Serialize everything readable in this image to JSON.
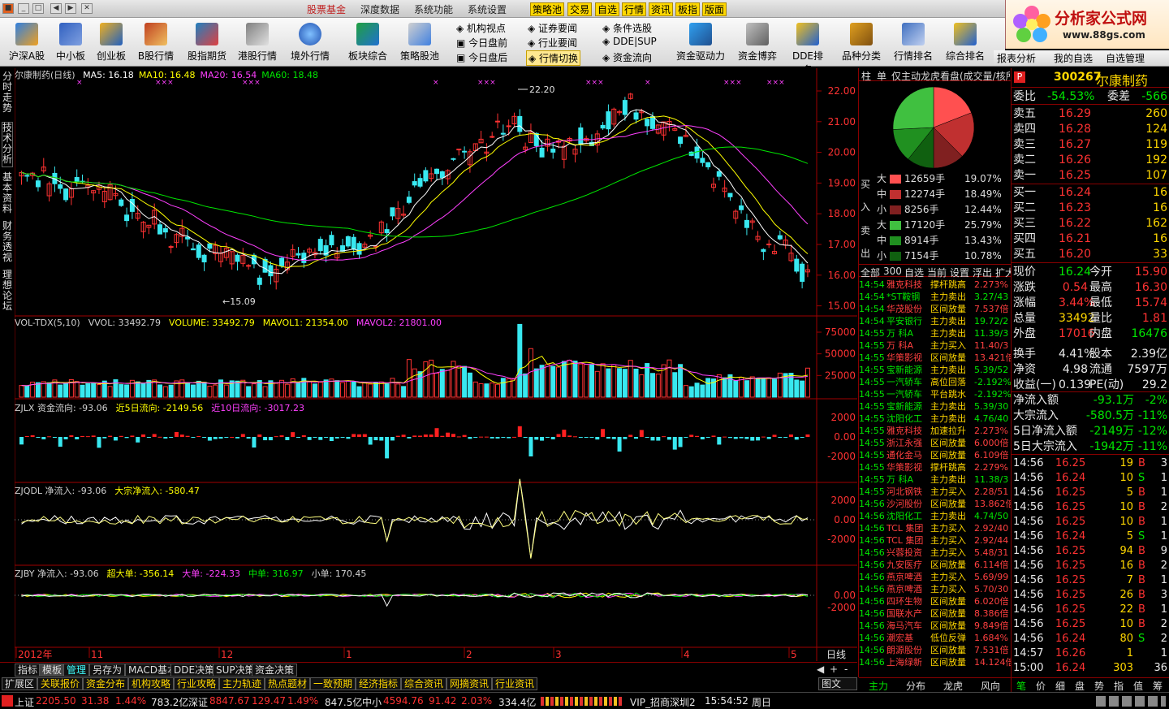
{
  "menu": {
    "items": [
      "股票基金",
      "深度数据",
      "系统功能",
      "系统设置"
    ],
    "tags": [
      "策略池",
      "交易",
      "自选",
      "行情",
      "资讯",
      "板指",
      "版面"
    ]
  },
  "logo": {
    "title": "分析家公式网",
    "url": "www.88gs.com"
  },
  "toolbar": {
    "big": [
      "沪深A股",
      "中小板",
      "创业板",
      "B股行情",
      "股指期货",
      "港股行情",
      "境外行情",
      "板块综合",
      "策略股池"
    ],
    "small1": [
      "机构视点",
      "今日盘前",
      "今日盘后"
    ],
    "small2": [
      "证券要闻",
      "行业要闻",
      "行情切换"
    ],
    "small3": [
      "条件选股",
      "DDE|SUP",
      "资金流向"
    ],
    "big2": [
      "资金驱动力",
      "资金博弈",
      "DDE排名",
      "品种分类",
      "行情排名",
      "综合排名",
      "报表分析",
      "我的自选",
      "自选管理"
    ]
  },
  "sidetabs": [
    "分时走势",
    "技术分析",
    "基本资料",
    "财务透视",
    "理想论坛"
  ],
  "main": {
    "title": "尔康制药(日线)",
    "ma": [
      {
        "label": "MA5: 16.18",
        "color": "#ffffff"
      },
      {
        "label": "MA10: 16.48",
        "color": "#ffff00"
      },
      {
        "label": "MA20: 16.54",
        "color": "#ff40ff"
      },
      {
        "label": "MA60: 18.48",
        "color": "#00e600"
      }
    ],
    "yticks": [
      "22.00",
      "21.00",
      "20.00",
      "19.00",
      "18.00",
      "17.00",
      "16.00",
      "15.00"
    ],
    "high_label": "22.20",
    "low_label": "15.09"
  },
  "vol": {
    "labels": [
      {
        "t": "VOL-TDX(5,10)",
        "c": "#d0d0d0"
      },
      {
        "t": "VVOL: 33492.79",
        "c": "#d0d0d0"
      },
      {
        "t": "VOLUME: 33492.79",
        "c": "#ffff00"
      },
      {
        "t": "MAVOL1: 21354.00",
        "c": "#ffff00"
      },
      {
        "t": "MAVOL2: 21801.00",
        "c": "#ff40ff"
      }
    ],
    "yticks": [
      "75000",
      "50000",
      "25000"
    ]
  },
  "zjlx": {
    "labels": [
      {
        "t": "ZJLX 资金流向: -93.06",
        "c": "#d0d0d0"
      },
      {
        "t": "近5日流向: -2149.56",
        "c": "#ffff00"
      },
      {
        "t": "近10日流向: -3017.23",
        "c": "#ff40ff"
      }
    ],
    "yticks": [
      "2000",
      "0.00",
      "-2000"
    ]
  },
  "zjqdl": {
    "labels": [
      {
        "t": "ZJQDL 净流入: -93.06",
        "c": "#d0d0d0"
      },
      {
        "t": "大宗净流入: -580.47",
        "c": "#ffff00"
      }
    ],
    "yticks": [
      "2000",
      "0.00",
      "-2000"
    ]
  },
  "zjby": {
    "labels": [
      {
        "t": "ZJBY 净流入: -93.06",
        "c": "#d0d0d0"
      },
      {
        "t": "超大单: -356.14",
        "c": "#ffff00"
      },
      {
        "t": "大单: -224.33",
        "c": "#ff40ff"
      },
      {
        "t": "中单: 316.97",
        "c": "#00e600"
      },
      {
        "t": "小单: 170.45",
        "c": "#d0d0d0"
      }
    ],
    "yticks": [
      "0.00",
      "-2000"
    ]
  },
  "xaxis": {
    "labels": [
      "2012年",
      "11",
      "12",
      "1",
      "2",
      "3",
      "4",
      "5"
    ],
    "period": "日线"
  },
  "bottomtabs": [
    "指标",
    "模板",
    "管理",
    "另存为",
    "MACD基本",
    "DDE决策",
    "SUP决策",
    "资金决策"
  ],
  "bottomtabs2": [
    "扩展区",
    "关联报价",
    "资金分布",
    "机构攻略",
    "行业攻略",
    "主力轨迹",
    "热点题材",
    "一致预期",
    "经济指标",
    "综合资讯",
    "网摘资讯",
    "行业资讯"
  ],
  "pie_panel": {
    "tabs": [
      "柱",
      "单",
      "仅主动",
      "龙虎看盘(成交量/核所"
    ],
    "flow": [
      {
        "side": "买入",
        "rows": [
          {
            "s": "大",
            "v": "12659手",
            "p": "19.07%",
            "c": "#ff5050"
          },
          {
            "s": "中",
            "v": "12274手",
            "p": "18.49%",
            "c": "#c03030"
          },
          {
            "s": "小",
            "v": "8256手",
            "p": "12.44%",
            "c": "#802020"
          }
        ]
      },
      {
        "side": "卖出",
        "rows": [
          {
            "s": "大",
            "v": "17120手",
            "p": "25.79%",
            "c": "#40c040"
          },
          {
            "s": "中",
            "v": "8914手",
            "p": "13.43%",
            "c": "#209020"
          },
          {
            "s": "小",
            "v": "7154手",
            "p": "10.78%",
            "c": "#106010"
          }
        ]
      }
    ],
    "slices": [
      19.07,
      18.49,
      12.44,
      10.78,
      13.43,
      25.79
    ]
  },
  "radar": {
    "tabs": [
      "全部",
      "300",
      "自选",
      "当前",
      "设置",
      "浮出",
      "扩大"
    ],
    "rows": [
      [
        "14:54",
        "雅克科技",
        "撑杆跳高",
        "2.273%",
        "r"
      ],
      [
        "14:54",
        "*ST鞍钢",
        "主力卖出",
        "3.27/43",
        "g"
      ],
      [
        "14:54",
        "华茂股份",
        "区间放量",
        "7.537倍",
        "r"
      ],
      [
        "14:54",
        "平安银行",
        "主力卖出",
        "19.72/2",
        "g"
      ],
      [
        "14:55",
        "万 科A",
        "主力卖出",
        "11.39/3",
        "g"
      ],
      [
        "14:55",
        "万 科A",
        "主力买入",
        "11.40/3",
        "r"
      ],
      [
        "14:55",
        "华策影视",
        "区间放量",
        "13.421倍",
        "r"
      ],
      [
        "14:55",
        "宝新能源",
        "主力卖出",
        "5.39/52",
        "g"
      ],
      [
        "14:55",
        "一汽轿车",
        "高位回落",
        "-2.192%",
        "g"
      ],
      [
        "14:55",
        "一汽轿车",
        "平台跳水",
        "-2.192%",
        "g"
      ],
      [
        "14:55",
        "宝新能源",
        "主力卖出",
        "5.39/30",
        "g"
      ],
      [
        "14:55",
        "沈阳化工",
        "主力卖出",
        "4.76/40",
        "g"
      ],
      [
        "14:55",
        "雅克科技",
        "加速拉升",
        "2.273%",
        "r"
      ],
      [
        "14:55",
        "浙江永强",
        "区间放量",
        "6.000倍",
        "r"
      ],
      [
        "14:55",
        "通化金马",
        "区间放量",
        "6.109倍",
        "r"
      ],
      [
        "14:55",
        "华策影视",
        "撑杆跳高",
        "2.279%",
        "r"
      ],
      [
        "14:55",
        "万 科A",
        "主力卖出",
        "11.38/3",
        "g"
      ],
      [
        "14:55",
        "河北钢铁",
        "主力买入",
        "2.28/51",
        "r"
      ],
      [
        "14:56",
        "沙河股份",
        "区间放量",
        "13.862倍",
        "r"
      ],
      [
        "14:56",
        "沈阳化工",
        "主力卖出",
        "4.74/50",
        "g"
      ],
      [
        "14:56",
        "TCL 集团",
        "主力买入",
        "2.92/40",
        "r"
      ],
      [
        "14:56",
        "TCL 集团",
        "主力买入",
        "2.92/44",
        "r"
      ],
      [
        "14:56",
        "兴蓉投资",
        "主力买入",
        "5.48/31",
        "r"
      ],
      [
        "14:56",
        "九安医疗",
        "区间放量",
        "6.114倍",
        "r"
      ],
      [
        "14:56",
        "燕京啤酒",
        "主力买入",
        "5.69/99",
        "r"
      ],
      [
        "14:56",
        "燕京啤酒",
        "主力买入",
        "5.70/30",
        "r"
      ],
      [
        "14:56",
        "四环生物",
        "区间放量",
        "6.020倍",
        "r"
      ],
      [
        "14:56",
        "国联水产",
        "区间放量",
        "8.386倍",
        "r"
      ],
      [
        "14:56",
        "海马汽车",
        "区间放量",
        "9.849倍",
        "r"
      ],
      [
        "14:56",
        "潮宏基",
        "低位反弹",
        "1.684%",
        "r"
      ],
      [
        "14:56",
        "朗源股份",
        "区间放量",
        "7.531倍",
        "r"
      ],
      [
        "14:56",
        "上海绿新",
        "区间放量",
        "14.124倍",
        "r"
      ]
    ],
    "bottom_tabs": [
      "主力",
      "分布",
      "龙虎",
      "风向"
    ]
  },
  "quote": {
    "code": "300267",
    "name": "尔康制药",
    "badge": "P",
    "weibi": {
      "l": "委比",
      "v": "-54.53%",
      "l2": "委差",
      "v2": "-566"
    },
    "asks": [
      [
        "卖五",
        "16.29",
        "260"
      ],
      [
        "卖四",
        "16.28",
        "124"
      ],
      [
        "卖三",
        "16.27",
        "119"
      ],
      [
        "卖二",
        "16.26",
        "192"
      ],
      [
        "卖一",
        "16.25",
        "107"
      ]
    ],
    "bids": [
      [
        "买一",
        "16.24",
        "16"
      ],
      [
        "买二",
        "16.23",
        "16"
      ],
      [
        "买三",
        "16.22",
        "162"
      ],
      [
        "买四",
        "16.21",
        "16"
      ],
      [
        "买五",
        "16.20",
        "33"
      ]
    ],
    "stats": [
      [
        [
          "现价",
          "16.24",
          "g"
        ],
        [
          "今开",
          "15.90",
          "r"
        ]
      ],
      [
        [
          "涨跌",
          "0.54",
          "r"
        ],
        [
          "最高",
          "16.30",
          "r"
        ]
      ],
      [
        [
          "涨幅",
          "3.44%",
          "r"
        ],
        [
          "最低",
          "15.74",
          "r"
        ]
      ],
      [
        [
          "总量",
          "33492",
          "y"
        ],
        [
          "量比",
          "1.81",
          "r"
        ]
      ],
      [
        [
          "外盘",
          "17016",
          "r"
        ],
        [
          "内盘",
          "16476",
          "g"
        ]
      ],
      [
        [
          "换手",
          "4.41%",
          "w"
        ],
        [
          "股本",
          "2.39亿",
          "w"
        ]
      ],
      [
        [
          "净资",
          "4.98",
          "w"
        ],
        [
          "流通",
          "7597万",
          "w"
        ]
      ],
      [
        [
          "收益(一)",
          "0.139",
          "w"
        ],
        [
          "PE(动)",
          "29.2",
          "w"
        ]
      ]
    ],
    "flows": [
      [
        "净流入额",
        "-93.1万",
        "-2%"
      ],
      [
        "大宗流入",
        "-580.5万",
        "-11%"
      ],
      [
        "5日净流入额",
        "-2149万",
        "-12%"
      ],
      [
        "5日大宗流入",
        "-1942万",
        "-11%"
      ]
    ],
    "ticks": [
      [
        "14:56",
        "16.25",
        "19",
        "B",
        "3"
      ],
      [
        "14:56",
        "16.24",
        "10",
        "S",
        "1"
      ],
      [
        "14:56",
        "16.25",
        "5",
        "B",
        "1"
      ],
      [
        "14:56",
        "16.25",
        "10",
        "B",
        "2"
      ],
      [
        "14:56",
        "16.25",
        "10",
        "B",
        "1"
      ],
      [
        "14:56",
        "16.24",
        "5",
        "S",
        "1"
      ],
      [
        "14:56",
        "16.25",
        "94",
        "B",
        "9"
      ],
      [
        "14:56",
        "16.25",
        "16",
        "B",
        "2"
      ],
      [
        "14:56",
        "16.25",
        "7",
        "B",
        "1"
      ],
      [
        "14:56",
        "16.25",
        "26",
        "B",
        "3"
      ],
      [
        "14:56",
        "16.25",
        "22",
        "B",
        "1"
      ],
      [
        "14:56",
        "16.25",
        "10",
        "B",
        "2"
      ],
      [
        "14:56",
        "16.24",
        "80",
        "S",
        "2"
      ],
      [
        "14:57",
        "16.26",
        "1",
        "",
        "1"
      ],
      [
        "15:00",
        "16.24",
        "303",
        "",
        "36"
      ]
    ],
    "bottom_tabs": [
      "笔",
      "价",
      "细",
      "盘",
      "势",
      "指",
      "值",
      "筹"
    ]
  },
  "status": {
    "sh": {
      "l": "上证",
      "v": "2205.50",
      "c": "31.38",
      "p": "1.44%",
      "a": "783.2亿"
    },
    "sz": {
      "l": "深证",
      "v": "8847.67",
      "c": "129.47",
      "p": "1.49%",
      "a": "847.5亿"
    },
    "zx": {
      "l": "中小",
      "v": "4594.76",
      "c": "91.42",
      "p": "2.03%",
      "a": "334.4亿"
    },
    "server": "VIP_招商深圳2",
    "time": "15:54:52",
    "day": "周日"
  }
}
